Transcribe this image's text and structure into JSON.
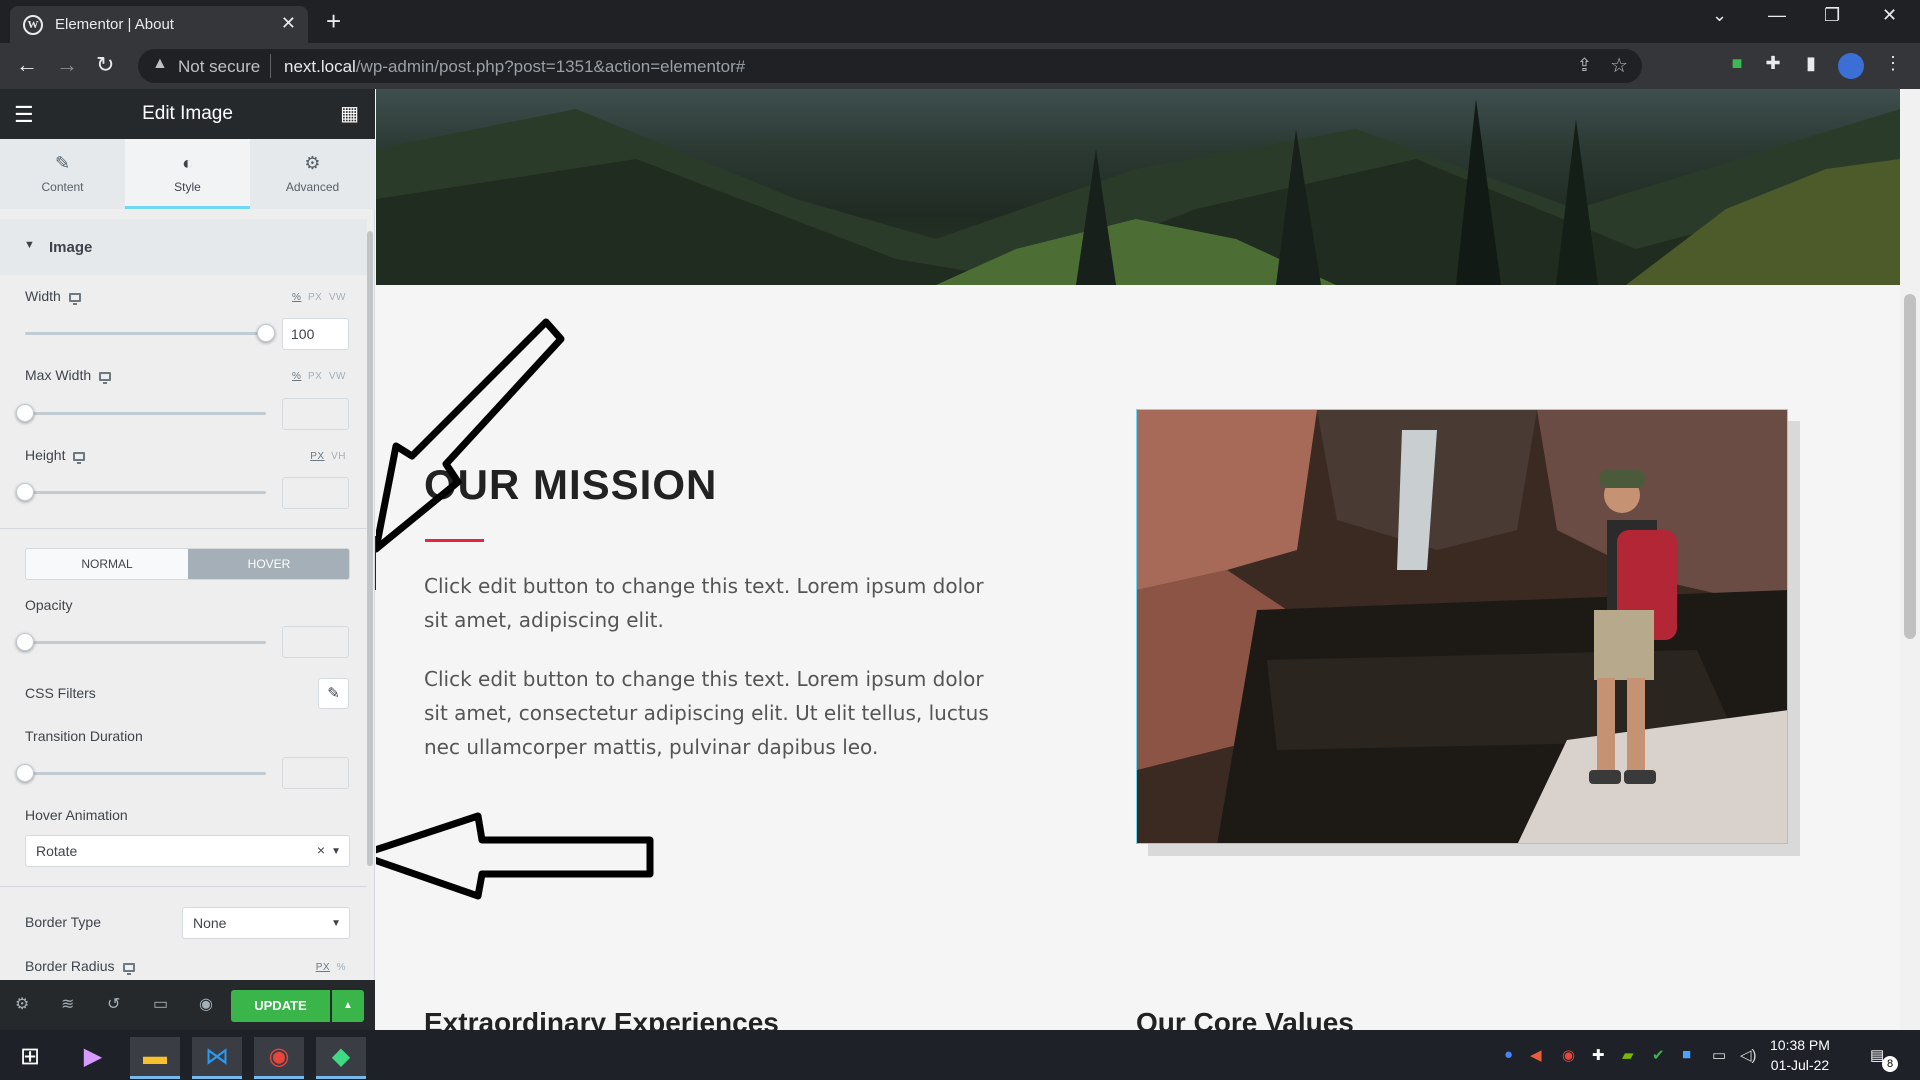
{
  "browser": {
    "tab_title": "Elementor | About",
    "security_label": "Not secure",
    "url_host": "next.local",
    "url_path": "/wp-admin/post.php?post=1351&action=elementor#"
  },
  "panel": {
    "header_title": "Edit Image",
    "tabs": [
      {
        "label": "Content",
        "icon": "pencil-icon"
      },
      {
        "label": "Style",
        "icon": "contrast-icon"
      },
      {
        "label": "Advanced",
        "icon": "gear-icon"
      }
    ],
    "active_tab": "Style",
    "section_title": "Image",
    "width": {
      "label": "Width",
      "units": [
        "%",
        "PX",
        "VW"
      ],
      "value": "100",
      "slider_percent": 100
    },
    "max_width": {
      "label": "Max Width",
      "units": [
        "%",
        "PX",
        "VW"
      ],
      "value": "",
      "slider_percent": 0
    },
    "height": {
      "label": "Height",
      "units": [
        "PX",
        "VH"
      ],
      "value": "",
      "slider_percent": 0
    },
    "state_tabs": {
      "normal": "NORMAL",
      "hover": "HOVER",
      "active": "HOVER"
    },
    "opacity": {
      "label": "Opacity",
      "value": "",
      "slider_percent": 0
    },
    "css_filters": {
      "label": "CSS Filters"
    },
    "transition_duration": {
      "label": "Transition Duration",
      "value": "",
      "slider_percent": 0
    },
    "hover_animation": {
      "label": "Hover Animation",
      "value": "Rotate"
    },
    "border_type": {
      "label": "Border Type",
      "value": "None"
    },
    "border_radius": {
      "label": "Border Radius",
      "units": [
        "PX",
        "%"
      ]
    },
    "footer": {
      "update_label": "UPDATE"
    }
  },
  "preview": {
    "heading": "OUR MISSION",
    "paragraph_1": "Click edit button to change this text. Lorem ipsum dolor sit amet, adipiscing elit.",
    "paragraph_2": "Click edit button to change this text. Lorem ipsum dolor sit amet, consectetur adipiscing elit. Ut elit tellus, luctus nec ullamcorper mattis, pulvinar dapibus leo.",
    "col_heading_1": "Extraordinary Experiences",
    "col_heading_2": "Our Core Values",
    "accent_color": "#e5263f",
    "selection_color": "#71d7f7"
  },
  "taskbar": {
    "time": "10:38 PM",
    "date": "01-Jul-22",
    "notification_count": "8"
  }
}
